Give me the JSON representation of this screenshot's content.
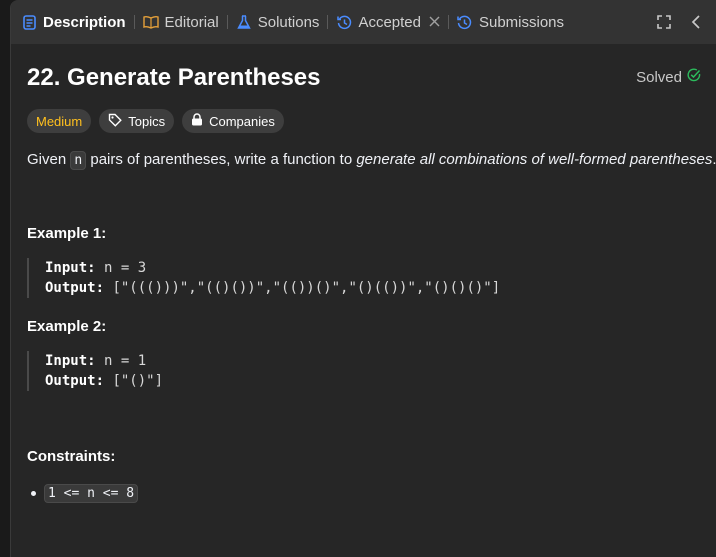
{
  "tabs": [
    {
      "label": "Description",
      "icon": "document-icon"
    },
    {
      "label": "Editorial",
      "icon": "book-icon"
    },
    {
      "label": "Solutions",
      "icon": "flask-icon"
    },
    {
      "label": "Accepted",
      "icon": "history-icon"
    },
    {
      "label": "Submissions",
      "icon": "history-icon"
    }
  ],
  "problem": {
    "title": "22. Generate Parentheses",
    "status": "Solved",
    "difficulty": "Medium",
    "topics_label": "Topics",
    "companies_label": "Companies",
    "desc_before": "Given ",
    "desc_code": "n",
    "desc_middle": " pairs of parentheses, write a function to ",
    "desc_em": "generate all combinations of well-formed parentheses",
    "desc_end": "."
  },
  "examples": [
    {
      "heading": "Example 1:",
      "input_label": "Input:",
      "input": " n = 3",
      "output_label": "Output:",
      "output": " [\"((()))\",\"(()())\",\"(())()\",\"()(())\",\"()()()\"]"
    },
    {
      "heading": "Example 2:",
      "input_label": "Input:",
      "input": " n = 1",
      "output_label": "Output:",
      "output": " [\"()\"]"
    }
  ],
  "constraints": {
    "heading": "Constraints:",
    "items": [
      "1 <= n <= 8"
    ]
  },
  "colors": {
    "difficulty_medium": "#ffc01e",
    "solved_check": "#2cbb5d",
    "tab_icon_blue": "#4a8cff"
  }
}
